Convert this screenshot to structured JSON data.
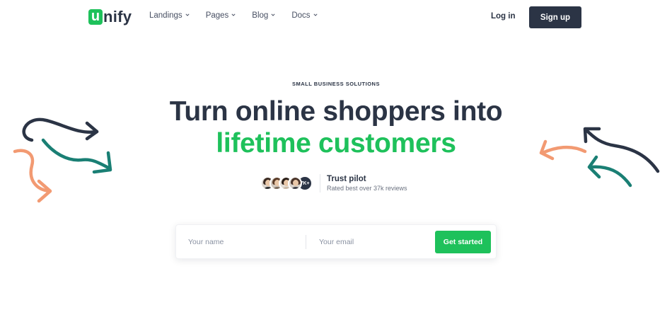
{
  "brand": {
    "logo_letter": "u",
    "logo_text": "nify",
    "accent": "#1ec15b",
    "dark": "#2b3445",
    "orange": "#f29a72",
    "teal": "#1a7f74"
  },
  "nav": {
    "items": [
      {
        "label": "Landings",
        "icon": "chevron-down-icon"
      },
      {
        "label": "Pages",
        "icon": "chevron-down-icon"
      },
      {
        "label": "Blog",
        "icon": "chevron-down-icon"
      },
      {
        "label": "Docs",
        "icon": "chevron-down-icon"
      }
    ],
    "login": "Log in",
    "signup": "Sign up"
  },
  "hero": {
    "eyebrow": "SMALL BUSINESS SOLUTIONS",
    "title_line1": "Turn online shoppers into",
    "title_line2": "lifetime customers"
  },
  "social_proof": {
    "count": "7K+",
    "title": "Trust pilot",
    "subtitle": "Rated best over 37k reviews"
  },
  "form": {
    "name_placeholder": "Your name",
    "email_placeholder": "Your email",
    "cta": "Get started"
  }
}
